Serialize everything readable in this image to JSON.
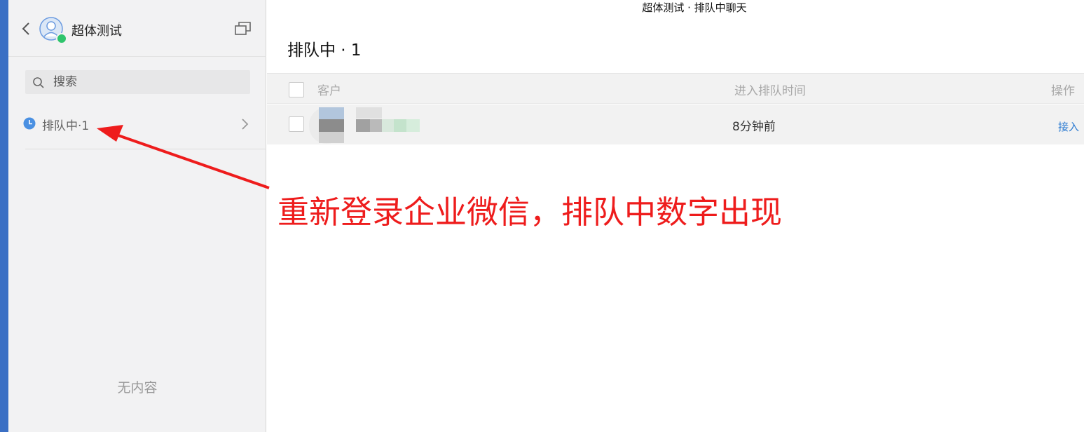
{
  "window": {
    "title": "超体测试 · 排队中聊天"
  },
  "sidebar": {
    "title": "超体测试",
    "search_placeholder": "搜索",
    "queue_item": {
      "label": "排队中·1"
    },
    "empty_text": "无内容"
  },
  "main": {
    "title": "排队中 · 1",
    "table": {
      "columns": [
        "客户",
        "进入排队时间",
        "操作"
      ],
      "rows": [
        {
          "customer": "",
          "queued_time": "8分钟前",
          "action": "接入"
        }
      ]
    }
  },
  "annotation": {
    "text": "重新登录企业微信，排队中数字出现"
  },
  "colors": {
    "accent": "#2a7ad1",
    "annotation": "#ee1c1c",
    "online": "#2ec46c",
    "clock": "#4a90e2",
    "strip": "#3a6fc4"
  }
}
